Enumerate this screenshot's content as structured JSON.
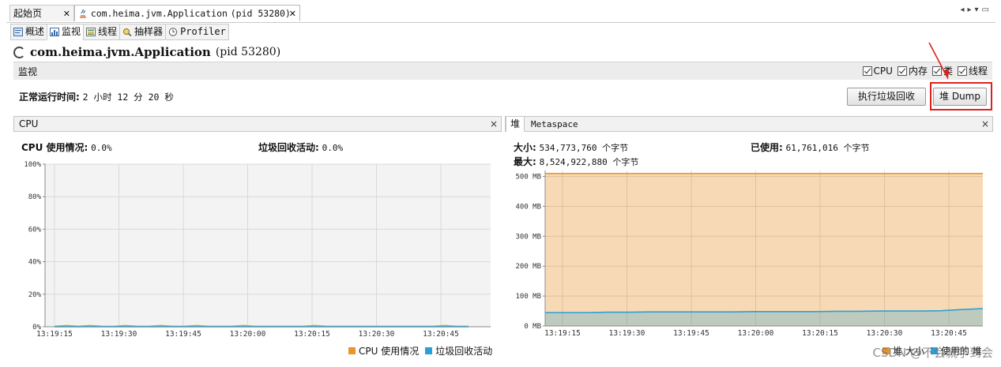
{
  "tabs": {
    "start_label": "起始页",
    "app_tab_label": "com.heima.jvm.Application",
    "app_tab_pid": "(pid 53280)"
  },
  "subtabs": [
    "概述",
    "监视",
    "线程",
    "抽样器",
    "Profiler"
  ],
  "app": {
    "name": "com.heima.jvm.Application",
    "pid": "(pid 53280)"
  },
  "monitor": {
    "label": "监视",
    "checks": [
      {
        "label": "CPU",
        "checked": true
      },
      {
        "label": "内存",
        "checked": true
      },
      {
        "label": "类",
        "checked": true
      },
      {
        "label": "线程",
        "checked": true
      }
    ],
    "uptime_label": "正常运行时间:",
    "uptime_value": "2 小时 12 分 20 秒",
    "gc_button": "执行垃圾回收",
    "dump_button": "堆 Dump"
  },
  "cpu_panel": {
    "title": "CPU",
    "close": "×",
    "usage_label": "CPU 使用情况:",
    "usage_value": "0.0%",
    "gc_label": "垃圾回收活动:",
    "gc_value": "0.0%",
    "legend": [
      "CPU 使用情况",
      "垃圾回收活动"
    ]
  },
  "heap_panel": {
    "tab_heap": "堆",
    "tab_meta": "Metaspace",
    "close": "×",
    "size_label": "大小:",
    "size_value": "534,773,760 个字节",
    "max_label": "最大:",
    "max_value": "8,524,922,880 个字节",
    "used_label": "已使用:",
    "used_value": "61,761,016 个字节",
    "legend": [
      "堆 大小",
      "使用的 堆"
    ]
  },
  "watermark": "CSDN @不会就学到会",
  "chart_data": [
    {
      "type": "line",
      "title": "CPU",
      "x": [
        "13:19:15",
        "13:19:30",
        "13:19:45",
        "13:20:00",
        "13:20:15",
        "13:20:30",
        "13:20:45"
      ],
      "yticks": [
        "0%",
        "20%",
        "40%",
        "60%",
        "80%",
        "100%"
      ],
      "ylim": [
        0,
        100
      ],
      "series": [
        {
          "name": "CPU 使用情况",
          "color": "#e8962c",
          "values": [
            0.3,
            0.8,
            0.3,
            0.8,
            0.3,
            0.2,
            0.8,
            0.3,
            0.3,
            0.8,
            0.3,
            0.3,
            0.8,
            0.3,
            0.3,
            0.3,
            0.8,
            0.3,
            0.3,
            0.3,
            0.3,
            0.3,
            0.8,
            0.3,
            0.3,
            0.3,
            0.3,
            0.3,
            0.3,
            0.3,
            0.3,
            0.3,
            0.3,
            0.8,
            0.3,
            0.3
          ]
        },
        {
          "name": "垃圾回收活动",
          "color": "#2aa0d6",
          "values": [
            0,
            0,
            0,
            0,
            0,
            0,
            0,
            0,
            0,
            0,
            0,
            0,
            0,
            0,
            0,
            0,
            0,
            0,
            0,
            0,
            0,
            0,
            0,
            0,
            0,
            0,
            0,
            0,
            0,
            0,
            0,
            0,
            0,
            0,
            0,
            0
          ]
        }
      ]
    },
    {
      "type": "area",
      "title": "堆",
      "x": [
        "13:19:15",
        "13:19:30",
        "13:19:45",
        "13:20:00",
        "13:20:15",
        "13:20:30",
        "13:20:45"
      ],
      "yticks": [
        "0 MB",
        "100 MB",
        "200 MB",
        "300 MB",
        "400 MB",
        "500 MB"
      ],
      "ylim": [
        0,
        520
      ],
      "series": [
        {
          "name": "堆 大小",
          "color": "#e8962c",
          "values": [
            510,
            510,
            510,
            510,
            510,
            510,
            510,
            510,
            510,
            510,
            510,
            510,
            510,
            510,
            510,
            510,
            510,
            510,
            510,
            510,
            510,
            510
          ]
        },
        {
          "name": "使用的 堆",
          "color": "#2aa0d6",
          "values": [
            45,
            45,
            45,
            46,
            46,
            47,
            47,
            47,
            47,
            47,
            48,
            48,
            48,
            48,
            49,
            49,
            50,
            50,
            50,
            51,
            55,
            58
          ]
        }
      ]
    }
  ]
}
